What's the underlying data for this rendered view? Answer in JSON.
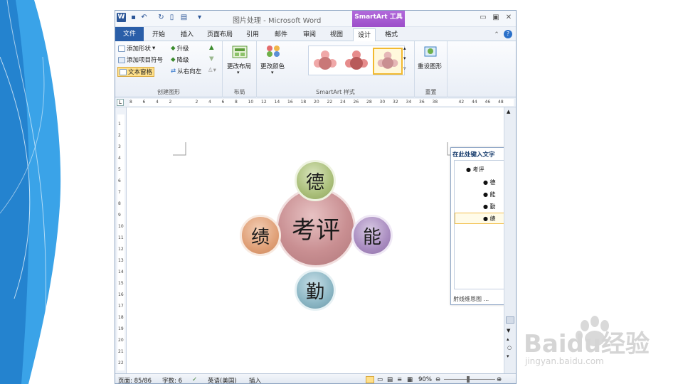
{
  "window": {
    "title": "图片处理 - Microsoft Word",
    "context_tab": "SmartArt 工具",
    "app_icon": "W",
    "min": "▭",
    "max": "▣",
    "close": "✕"
  },
  "tabs": [
    "文件",
    "开始",
    "插入",
    "页面布局",
    "引用",
    "邮件",
    "审阅",
    "视图",
    "设计",
    "格式"
  ],
  "ribbon": {
    "create_graphic": {
      "add_shape": "添加形状",
      "add_bullet": "添加项目符号",
      "text_pane": "文本窗格",
      "promote": "升级",
      "demote": "降级",
      "rtl": "从右向左",
      "label": "创建图形"
    },
    "layout": {
      "change_layout": "更改布局",
      "label": "布局"
    },
    "styles": {
      "change_colors": "更改颜色",
      "label": "SmartArt 样式"
    },
    "reset": {
      "reset_graphic": "重设图形",
      "label": "重置"
    }
  },
  "ruler_ticks": [
    "8",
    "6",
    "4",
    "2",
    "",
    "2",
    "4",
    "6",
    "8",
    "10",
    "12",
    "14",
    "16",
    "18",
    "20",
    "22",
    "24",
    "26",
    "28",
    "30",
    "32",
    "34",
    "36",
    "38",
    "",
    "42",
    "44",
    "46",
    "48"
  ],
  "vruler_ticks": [
    "1",
    "2",
    "3",
    "4",
    "5",
    "6",
    "7",
    "8",
    "9",
    "10",
    "11",
    "12",
    "13",
    "14",
    "15",
    "16",
    "17",
    "18",
    "19",
    "20",
    "21",
    "22"
  ],
  "smartart": {
    "center": "考评",
    "top": "德",
    "right": "能",
    "bottom": "勤",
    "left": "绩"
  },
  "text_pane": {
    "title": "在此处键入文字",
    "items": [
      "考评",
      "德",
      "能",
      "勤",
      "绩"
    ],
    "footer": "射线维恩图 ..."
  },
  "status": {
    "page": "页面: 85/86",
    "words": "字数: 6",
    "lang": "英语(美国)",
    "mode": "插入",
    "zoom": "90%"
  },
  "watermark": {
    "brand": "Baidu经验",
    "url": "jingyan.baidu.com"
  },
  "colors": {
    "center": "#c98f92",
    "top": "#aabf7a",
    "right": "#a98cc0",
    "bottom": "#8bb6c4",
    "left": "#e0a077",
    "ribbon_accent": "#2a5ea8",
    "context_purple": "#9c4dc9"
  }
}
